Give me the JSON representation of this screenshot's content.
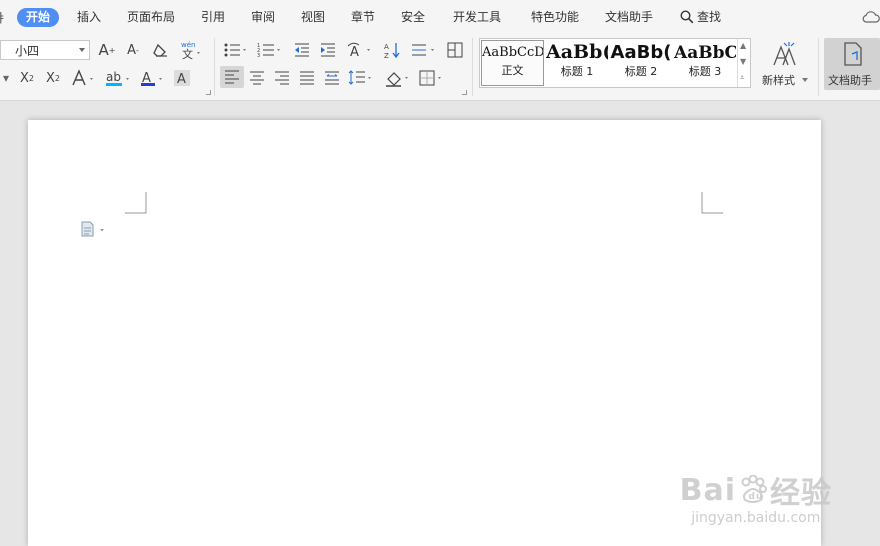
{
  "menubar": {
    "leading_glyph": "ǂ",
    "tabs": [
      "开始",
      "插入",
      "页面布局",
      "引用",
      "审阅",
      "视图",
      "章节",
      "安全",
      "开发工具",
      "特色功能",
      "文档助手"
    ],
    "active_tab": "开始",
    "search_label": "查找"
  },
  "ribbon": {
    "font_size_value": "小四",
    "row1_font_tools": [
      "increase-font-size",
      "decrease-font-size",
      "clear-format",
      "phonetic-guide"
    ],
    "row2_font_tools": [
      "superscript",
      "subscript",
      "text-effect",
      "highlight",
      "font-color",
      "character-shading"
    ],
    "paragraph_tools": [
      "bullets",
      "numbering",
      "decrease-indent",
      "increase-indent",
      "change-case",
      "sort",
      "line-spacing-show",
      "border-layout",
      "align-left",
      "align-center",
      "align-right",
      "justify",
      "distributed",
      "line-spacing",
      "shading",
      "borders"
    ],
    "styles": [
      {
        "sample": "AaBbCcDd",
        "label": "正文",
        "selected": true
      },
      {
        "sample": "AaBb(",
        "label": "标题 1",
        "selected": false
      },
      {
        "sample": "AaBb(",
        "label": "标题 2",
        "selected": false
      },
      {
        "sample": "AaBbC",
        "label": "标题 3",
        "selected": false
      }
    ],
    "new_style_label": "新样式",
    "assistant_label": "文档助手",
    "colors": {
      "accent": "#4f8ef3",
      "highlight": "#00b7ff",
      "font_color": "#1f3fd9"
    }
  },
  "watermark": {
    "brand_latin_1": "Bai",
    "brand_latin_2": "u",
    "brand_cn": "经验",
    "url": "jingyan.baidu.com"
  }
}
